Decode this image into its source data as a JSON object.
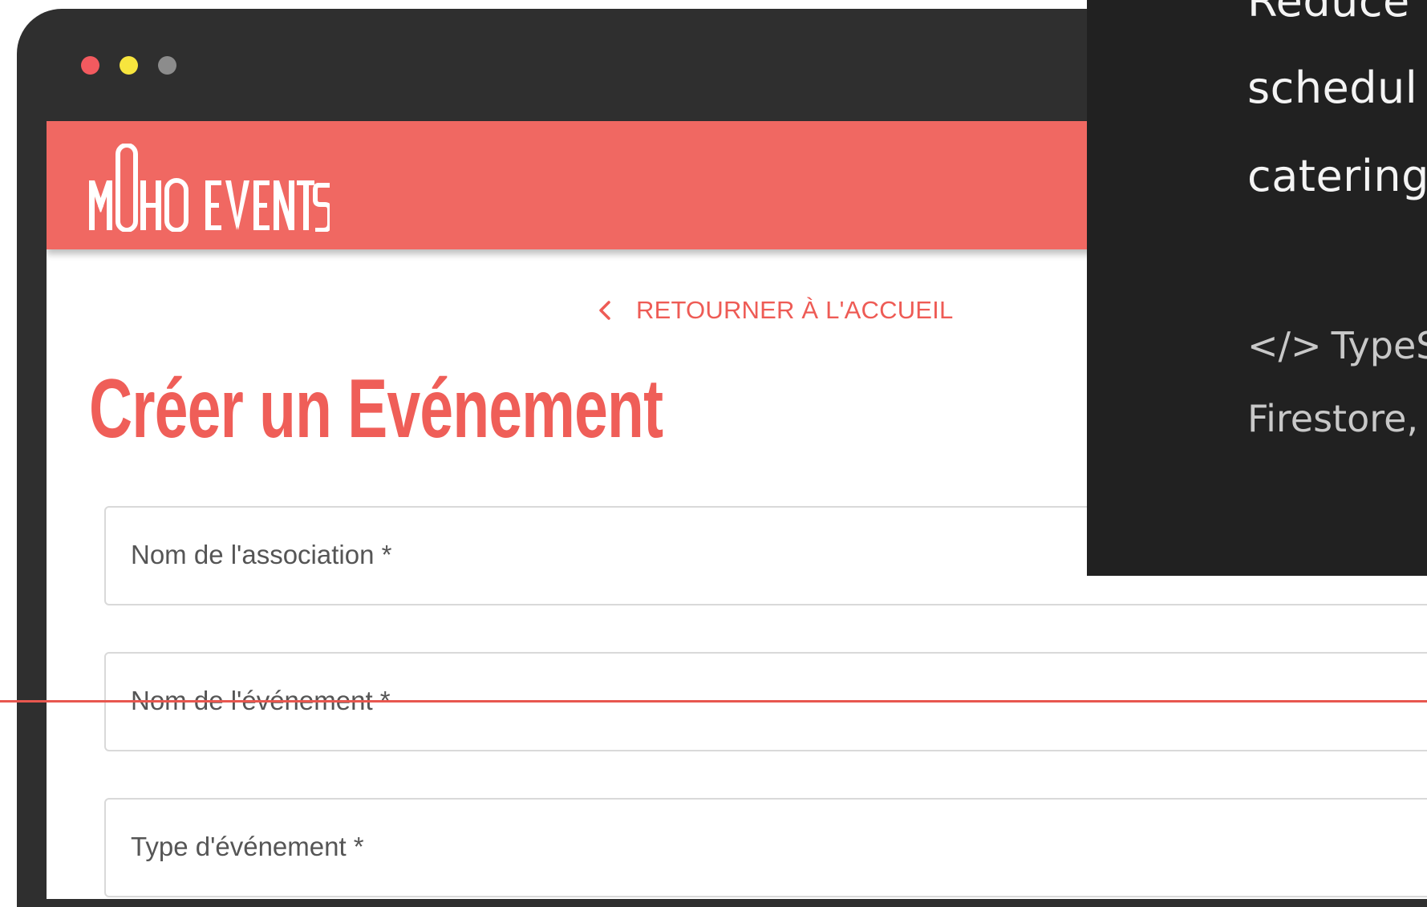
{
  "window": {
    "controls": [
      "close",
      "minimize",
      "zoom"
    ]
  },
  "header": {
    "logo_text": "MOHO EVENTS",
    "background_color": "#f06862"
  },
  "nav": {
    "back_label": "RETOURNER À L'ACCUEIL",
    "back_icon": "chevron-left-icon"
  },
  "main": {
    "title": "Créer un Evénement",
    "fields": [
      {
        "label": "Nom de l'association *"
      },
      {
        "label": "Nom de l'événement *"
      },
      {
        "label": "Type d'événement *"
      }
    ]
  },
  "overlay": {
    "description_lines": [
      "Reduce",
      "schedul",
      "catering"
    ],
    "tech_lines": [
      "TypeS",
      "Firestore,"
    ],
    "tech_icon": "code-icon"
  },
  "colors": {
    "accent": "#ef5e58",
    "frame": "#2f2f2f",
    "overlay_bg": "#212121"
  }
}
